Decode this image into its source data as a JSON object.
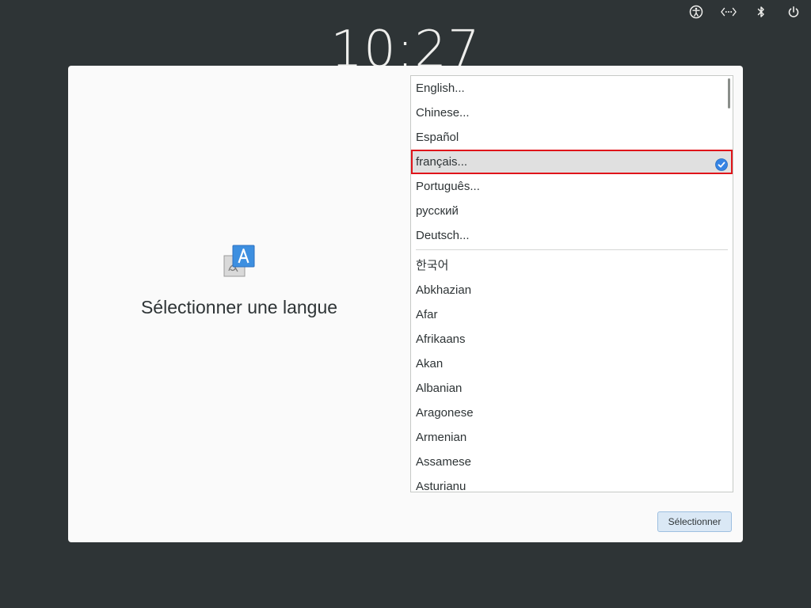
{
  "clock": {
    "time": "10:27"
  },
  "tray": {
    "icons": [
      "accessibility-icon",
      "network-icon",
      "bluetooth-icon",
      "power-icon"
    ]
  },
  "dialog": {
    "prompt": "Sélectionner une langue",
    "languages_top": [
      "English...",
      "Chinese...",
      "Español",
      "français...",
      "Português...",
      "русский",
      "Deutsch..."
    ],
    "selected_language": "français...",
    "languages_more": [
      "한국어",
      "Abkhazian",
      "Afar",
      "Afrikaans",
      "Akan",
      "Albanian",
      "Aragonese",
      "Armenian",
      "Assamese",
      "Asturianu"
    ],
    "select_button_label": "Sélectionner"
  },
  "colors": {
    "background": "#2e3436",
    "dialog": "#fafafa",
    "selection_highlight": "#e0151a",
    "check_blue": "#3584e4",
    "button": "#dae8f5"
  }
}
